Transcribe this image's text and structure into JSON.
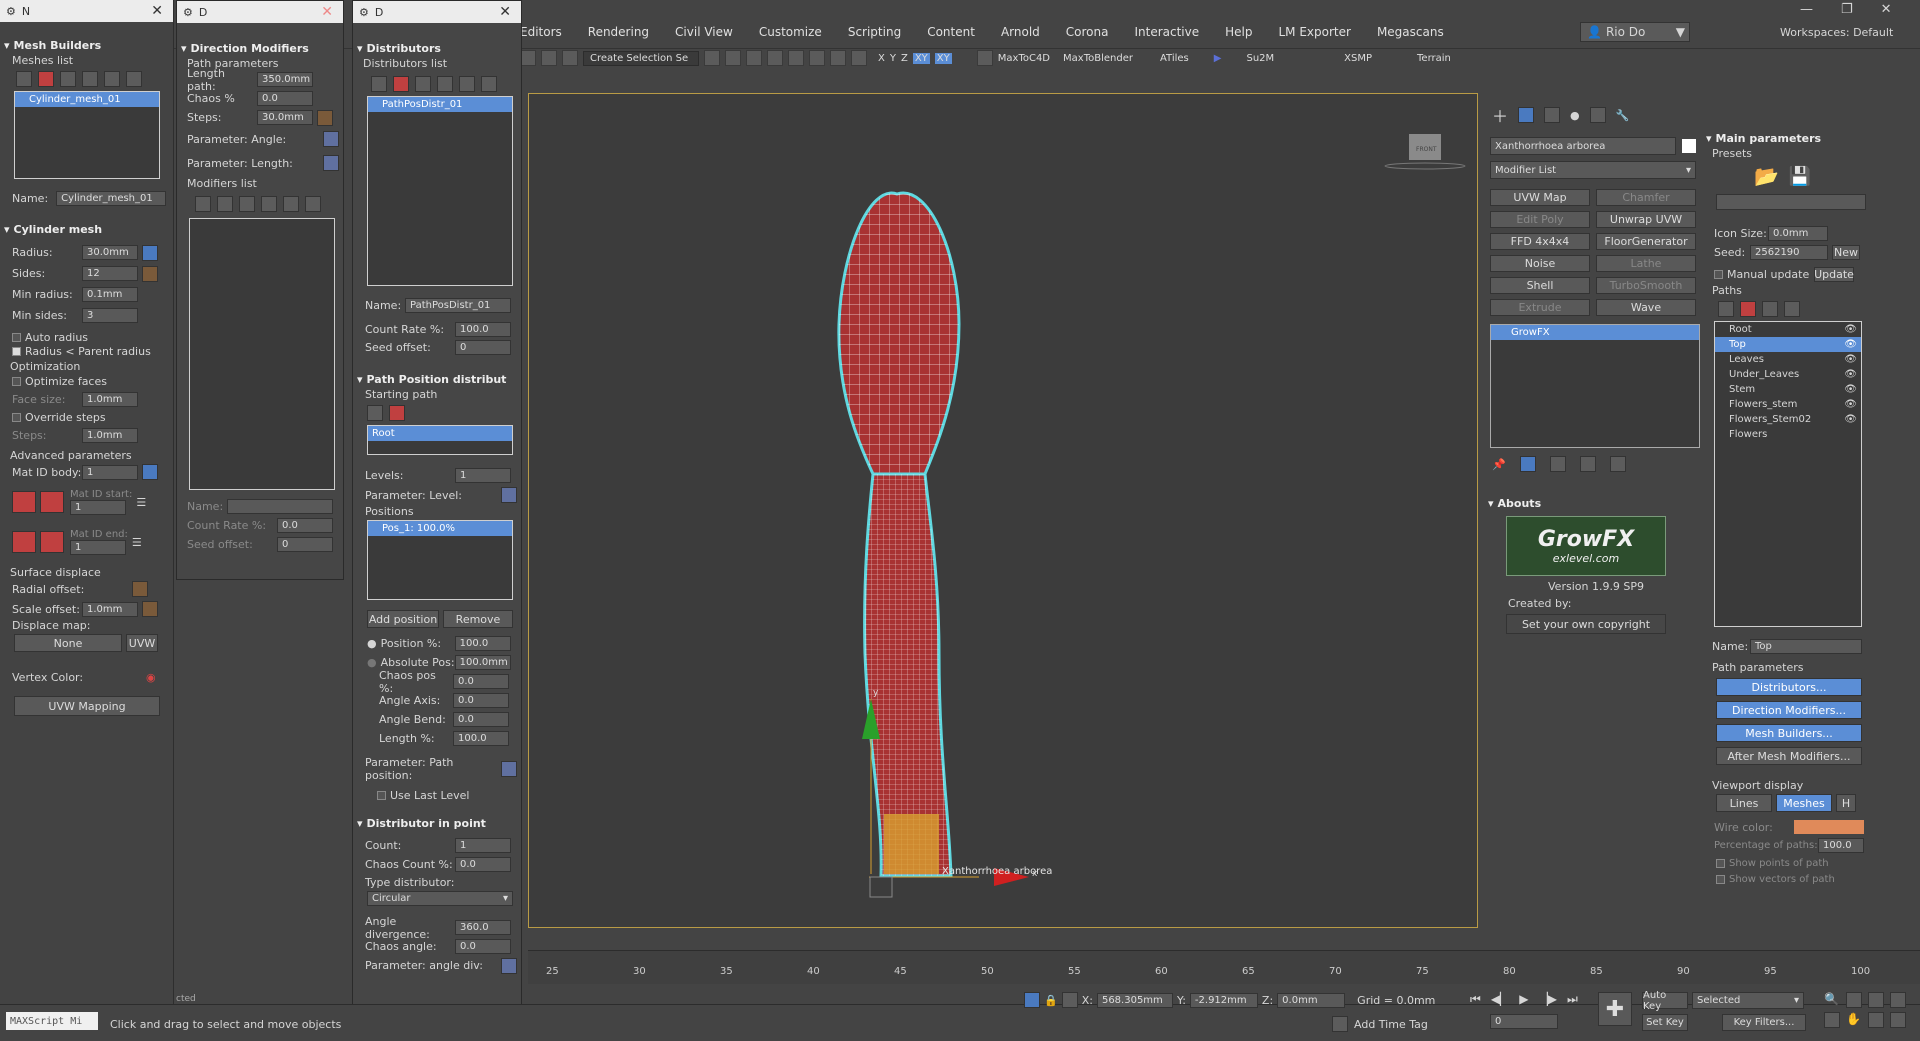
{
  "app": {
    "menu": [
      "Editors",
      "Rendering",
      "Civil View",
      "Customize",
      "Scripting",
      "Content",
      "Arnold",
      "Corona",
      "Interactive",
      "Help",
      "LM Exporter",
      "Megascans"
    ],
    "user": "Rio Do",
    "workspace_label": "Workspaces:",
    "workspace_value": "Default",
    "win_buttons": [
      "—",
      "❐",
      "✕"
    ]
  },
  "toolbar": {
    "selection_set": "Create Selection Se",
    "axes": [
      "X",
      "Y",
      "Z",
      "XY",
      "XY"
    ],
    "plugins": [
      "MaxToC4D",
      "MaxToBlender",
      "ATiles",
      "Su2M",
      "XSMP",
      "Terrain"
    ]
  },
  "mesh_builders": {
    "title": "Mesh Builders",
    "list_label": "Meshes list",
    "item": "Cylinder_mesh_01",
    "name_label": "Name:",
    "name_value": "Cylinder_mesh_01",
    "cyl_head": "Cylinder mesh",
    "radius_l": "Radius:",
    "radius_v": "30.0mm",
    "sides_l": "Sides:",
    "sides_v": "12",
    "minrad_l": "Min radius:",
    "minrad_v": "0.1mm",
    "minsides_l": "Min sides:",
    "minsides_v": "3",
    "autoradius": "Auto radius",
    "radiusparent": "Radius < Parent radius",
    "opt_head": "Optimization",
    "optfaces": "Optimize faces",
    "facesize_l": "Face size:",
    "facesize_v": "1.0mm",
    "override": "Override steps",
    "steps_l": "Steps:",
    "steps_v": "1.0mm",
    "adv_head": "Advanced parameters",
    "matid_l": "Mat ID body:",
    "matid_v": "1",
    "matstart_l": "Mat ID start:",
    "matstart_v": "1",
    "matend_l": "Mat ID end:",
    "matend_v": "1",
    "surf_head": "Surface displace",
    "radoff_l": "Radial offset:",
    "scaleoff_l": "Scale offset:",
    "scaleoff_v": "1.0mm",
    "dispmap_l": "Displace map:",
    "none_btn": "None",
    "uvw_btn": "UVW",
    "vcolor_l": "Vertex Color:",
    "uvwmap_btn": "UVW Mapping"
  },
  "direction_mod": {
    "title": "Direction Modifiers",
    "path_params": "Path parameters",
    "length_l": "Length path:",
    "length_v": "350.0mm",
    "chaos_l": "Chaos %",
    "chaos_v": "0.0",
    "steps_l": "Steps:",
    "steps_v": "30.0mm",
    "pangle": "Parameter: Angle:",
    "plength": "Parameter: Length:",
    "modlist": "Modifiers list",
    "name_l": "Name:",
    "count_l": "Count Rate %:",
    "count_v": "0.0",
    "seed_l": "Seed offset:",
    "seed_v": "0"
  },
  "distributors": {
    "title": "Distributors",
    "list_label": "Distributors list",
    "item": "PathPosDistr_01",
    "name_l": "Name:",
    "name_v": "PathPosDistr_01",
    "count_l": "Count Rate %:",
    "count_v": "100.0",
    "seed_l": "Seed offset:",
    "seed_v": "0",
    "ppd_head": "Path Position distribut",
    "start_l": "Starting path",
    "root": "Root",
    "levels_l": "Levels:",
    "levels_v": "1",
    "plevel": "Parameter: Level:",
    "positions_l": "Positions",
    "pos_item": "Pos_1: 100.0%",
    "addpos": "Add position",
    "remove": "Remove",
    "position_l": "Position %:",
    "position_v": "100.0",
    "abspos_l": "Absolute Pos:",
    "abspos_v": "100.0mm",
    "chaospos_l": "Chaos pos %:",
    "chaospos_v": "0.0",
    "angaxis_l": "Angle Axis:",
    "angaxis_v": "0.0",
    "angbend_l": "Angle Bend:",
    "angbend_v": "0.0",
    "lengthp_l": "Length %:",
    "lengthp_v": "100.0",
    "ppos": "Parameter: Path position:",
    "uselast": "Use Last Level",
    "dip_head": "Distributor in point",
    "cnt_l": "Count:",
    "cnt_v": "1",
    "chaoscnt_l": "Chaos Count %:",
    "chaoscnt_v": "0.0",
    "type_l": "Type distributor:",
    "type_v": "Circular",
    "angdiv_l": "Angle divergence:",
    "angdiv_v": "360.0",
    "chaosang_l": "Chaos angle:",
    "chaosang_v": "0.0",
    "pangdiv": "Parameter: angle div:"
  },
  "modify_panel": {
    "object_name": "Xanthorrhoea arborea",
    "modifier_list": "Modifier List",
    "buttons": [
      [
        "UVW Map",
        "Chamfer"
      ],
      [
        "Edit Poly",
        "Unwrap UVW"
      ],
      [
        "FFD 4x4x4",
        "FloorGenerator"
      ],
      [
        "Noise",
        "Lathe"
      ],
      [
        "Shell",
        "TurboSmooth"
      ],
      [
        "Extrude",
        "Wave"
      ]
    ],
    "stack_item": "GrowFX",
    "abouts": "Abouts",
    "logo_main": "GrowFX",
    "logo_sub": "exlevel.com",
    "version": "Version 1.9.9 SP9",
    "created": "Created by:",
    "copyright": "Set your own copyright"
  },
  "main_params": {
    "title": "Main parameters",
    "presets": "Presets",
    "iconsize_l": "Icon Size:",
    "iconsize_v": "0.0mm",
    "seed_l": "Seed:",
    "seed_v": "2562190",
    "new_btn": "New",
    "manual": "Manual update",
    "update_btn": "Update",
    "paths_l": "Paths",
    "paths": [
      "Root",
      "Top",
      "Leaves",
      "Under_Leaves",
      "Stem",
      "Flowers_stem",
      "Flowers_Stem02",
      "Flowers"
    ],
    "name_l": "Name:",
    "name_v": "Top",
    "pathparams": "Path parameters",
    "distr_btn": "Distributors...",
    "dir_btn": "Direction Modifiers...",
    "mesh_btn": "Mesh Builders...",
    "after_btn": "After Mesh Modifiers...",
    "vdisplay": "Viewport display",
    "lines_btn": "Lines",
    "meshes_btn": "Meshes",
    "h_btn": "H",
    "wire_l": "Wire color:",
    "perc_l": "Percentage of paths:",
    "perc_v": "100.0",
    "showpoints": "Show points of path",
    "showvectors": "Show vectors of path",
    "wire_color": "#e08a5a"
  },
  "viewport": {
    "label": "Xanthorrhoea arborea",
    "axis_x": "x",
    "axis_y": "y",
    "viewcube": "FRONT"
  },
  "timeline": {
    "ticks": [
      "25",
      "30",
      "35",
      "40",
      "45",
      "50",
      "55",
      "60",
      "65",
      "70",
      "75",
      "80",
      "85",
      "90",
      "95",
      "100"
    ]
  },
  "status": {
    "script": "MAXScript Mi",
    "hint": "Click and drag to select and move objects",
    "cut": "cted",
    "x_l": "X:",
    "x_v": "568.305mm",
    "y_l": "Y:",
    "y_v": "-2.912mm",
    "z_l": "Z:",
    "z_v": "0.0mm",
    "grid": "Grid = 0.0mm",
    "addtag": "Add Time Tag",
    "autokey": "Auto Key",
    "selected": "Selected",
    "setkey": "Set Key",
    "keyfilters": "Key Filters...",
    "frame": "0"
  }
}
